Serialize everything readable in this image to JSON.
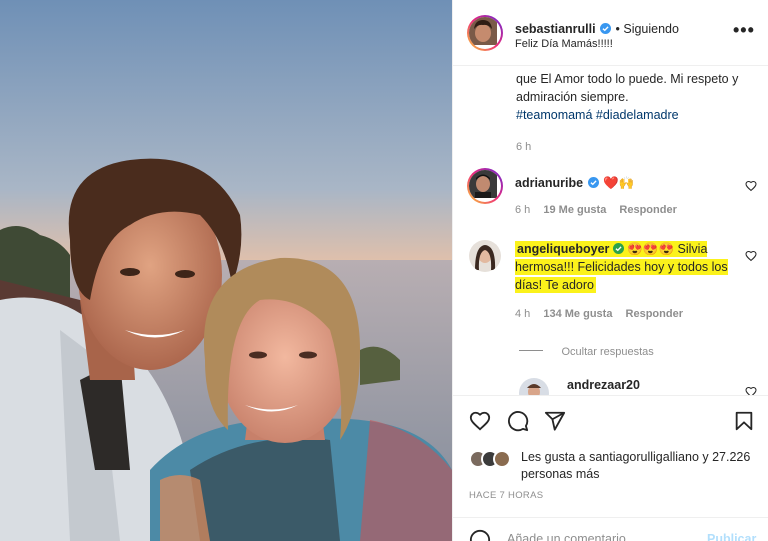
{
  "post": {
    "author": "sebastianrulli",
    "follow_status": "Siguiendo",
    "subtitle": "Feliz Día Mamás!!!!!",
    "caption": "que El Amor todo lo puede. Mi respeto y admiración siempre.",
    "hashtags": "#teamomamá #diadelamadre",
    "caption_time": "6 h"
  },
  "comments": [
    {
      "user": "adrianuribe",
      "text": "❤️🙌",
      "time": "6 h",
      "likes": "19 Me gusta",
      "reply": "Responder"
    },
    {
      "user": "angeliqueboyer",
      "text": "😍😍😍 Silvia hermosa!!! Felicidades hoy y todos los días! Te adoro",
      "time": "4 h",
      "likes": "134 Me gusta",
      "reply": "Responder",
      "hide_replies": "Ocultar respuestas"
    },
    {
      "user": "andrezaar20"
    }
  ],
  "footer": {
    "likes_text": "Les gusta a santiagorulligalliano y 27.226 personas más",
    "time_ago": "HACE 7 HORAS",
    "add_comment_placeholder": "Añade un comentario...",
    "publish": "Publicar"
  },
  "icons": {
    "like": "heart-icon",
    "comment": "comment-icon",
    "share": "share-icon",
    "save": "bookmark-icon",
    "options": "more-options-icon",
    "verified": "verified-badge-icon"
  },
  "colors": {
    "highlight": "#fbf21b",
    "verified": "#3897f0",
    "link": "#00376b",
    "muted": "#8e8e8e"
  }
}
